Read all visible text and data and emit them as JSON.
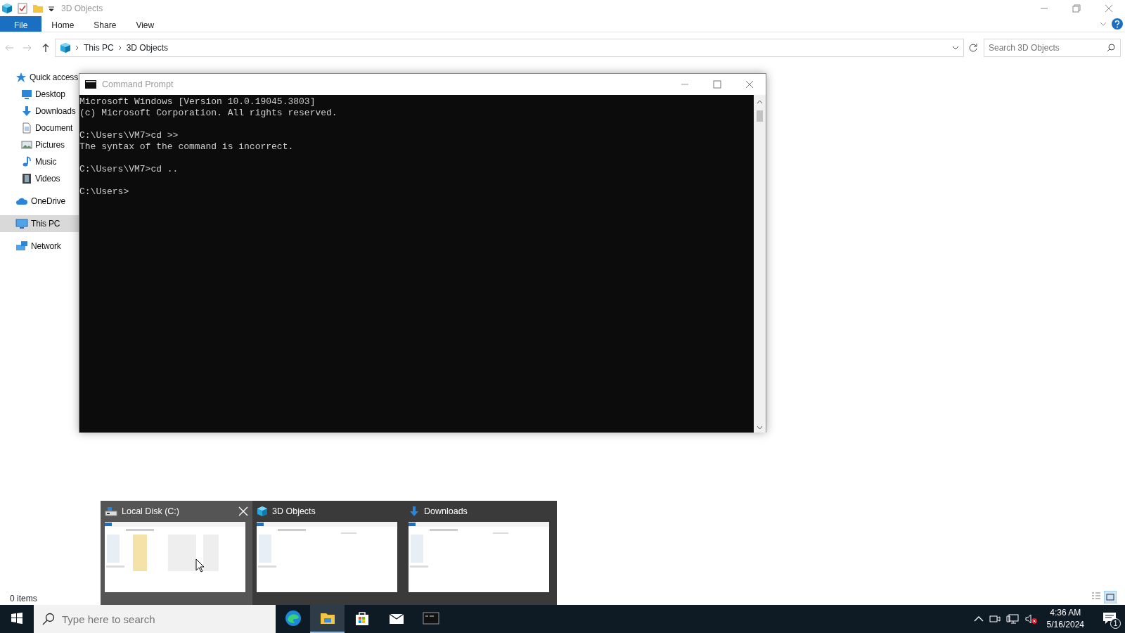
{
  "explorer": {
    "title": "3D Objects",
    "ribbon_tabs": [
      {
        "label": "File",
        "kind": "file",
        "selected": false
      },
      {
        "label": "Home",
        "kind": "tab",
        "selected": false
      },
      {
        "label": "Share",
        "kind": "tab",
        "selected": false
      },
      {
        "label": "View",
        "kind": "tab",
        "selected": false
      }
    ],
    "breadcrumb": [
      "This PC",
      "3D Objects"
    ],
    "search": {
      "placeholder": "Search 3D Objects"
    },
    "sidebar": [
      {
        "label": "Quick access",
        "kind": "star",
        "selected": false,
        "children": [
          {
            "label": "Desktop",
            "kind": "desktop",
            "selected": false
          },
          {
            "label": "Downloads",
            "kind": "download",
            "selected": false
          },
          {
            "label": "Document",
            "kind": "document",
            "selected": false
          },
          {
            "label": "Pictures",
            "kind": "pictures",
            "selected": false
          },
          {
            "label": "Music",
            "kind": "music",
            "selected": false
          },
          {
            "label": "Videos",
            "kind": "videos",
            "selected": false
          }
        ]
      },
      {
        "label": "OneDrive",
        "kind": "cloud",
        "selected": false
      },
      {
        "label": "This PC",
        "kind": "pc",
        "selected": true
      },
      {
        "label": "Network",
        "kind": "network",
        "selected": false
      }
    ],
    "status": "0 items"
  },
  "console": {
    "title": "Command Prompt",
    "blocks": [
      [
        "Microsoft Windows [Version 10.0.19045.3803]",
        "(c) Microsoft Corporation. All rights reserved."
      ],
      [
        "C:\\Users\\VM7>cd >>",
        "The syntax of the command is incorrect."
      ],
      [
        "C:\\Users\\VM7>cd .."
      ],
      [
        "C:\\Users>"
      ]
    ]
  },
  "previews": [
    {
      "title": "Local Disk (C:)",
      "kind": "drive",
      "hovered": true
    },
    {
      "title": "3D Objects",
      "kind": "cube",
      "hovered": false
    },
    {
      "title": "Downloads",
      "kind": "download",
      "hovered": false
    }
  ],
  "taskbar": {
    "search": {
      "placeholder": "Type here to search"
    },
    "apps": [
      {
        "kind": "edge",
        "selected": false
      },
      {
        "kind": "explorer",
        "selected": true
      },
      {
        "kind": "store",
        "selected": false
      },
      {
        "kind": "mail",
        "selected": false
      },
      {
        "kind": "console",
        "selected": false
      }
    ],
    "time": "4:36 AM",
    "date": "5/16/2024",
    "notifications": "1"
  }
}
